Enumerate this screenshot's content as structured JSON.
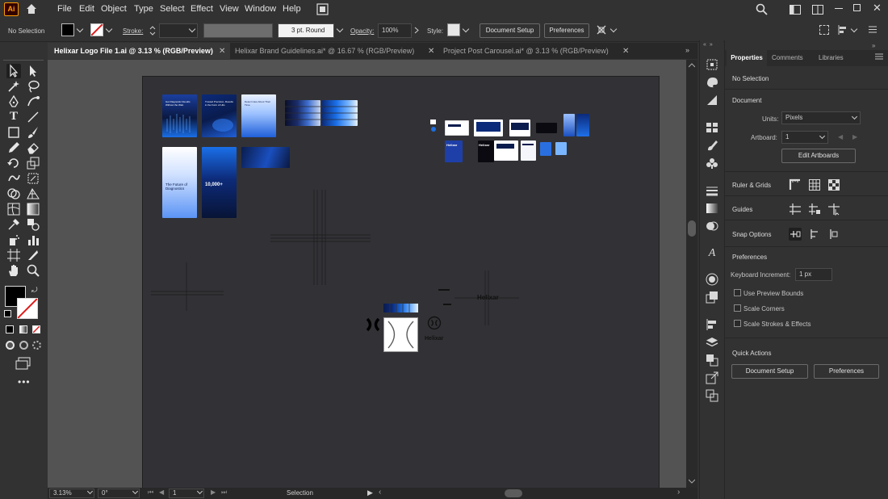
{
  "app": {
    "logo": "Ai"
  },
  "menu": [
    "File",
    "Edit",
    "Object",
    "Type",
    "Select",
    "Effect",
    "View",
    "Window",
    "Help"
  ],
  "control": {
    "selection": "No Selection",
    "stroke_label": "Stroke:",
    "stroke_profile": "3 pt. Round",
    "opacity_label": "Opacity:",
    "opacity_value": "100%",
    "style_label": "Style:",
    "document_setup": "Document Setup",
    "preferences": "Preferences"
  },
  "tabs": [
    {
      "label": "Helixar Logo File 1.ai @ 3.13 % (RGB/Preview)",
      "active": true
    },
    {
      "label": "Helixar Brand Guidelines.ai* @ 16.67 % (RGB/Preview)",
      "active": false
    },
    {
      "label": "Project Post Carousel.ai* @ 3.13 % (RGB/Preview)",
      "active": false
    }
  ],
  "artwork": {
    "posters": [
      "Get Diagnostic Results Without the Wait.",
      "Trusted Precision, Results in the Form of Hits",
      "Detect Care About Their Time.",
      "The Future of Diagnostics",
      "10,000+"
    ],
    "brand_name": "Helixar",
    "wordmark": "Helixar"
  },
  "status": {
    "zoom": "3.13%",
    "rotation": "0°",
    "artboard": "1",
    "tool": "Selection"
  },
  "panel": {
    "tabs": [
      "Properties",
      "Comments",
      "Libraries"
    ],
    "no_selection": "No Selection",
    "document": "Document",
    "units_label": "Units:",
    "units_value": "Pixels",
    "artboard_label": "Artboard:",
    "artboard_value": "1",
    "edit_artboards": "Edit Artboards",
    "ruler_grids": "Ruler & Grids",
    "guides": "Guides",
    "snap_options": "Snap Options",
    "preferences": "Preferences",
    "keyboard_increment_label": "Keyboard Increment:",
    "keyboard_increment_value": "1 px",
    "use_preview_bounds": "Use Preview Bounds",
    "scale_corners": "Scale Corners",
    "scale_strokes": "Scale Strokes & Effects",
    "quick_actions": "Quick Actions",
    "qa_document_setup": "Document Setup",
    "qa_preferences": "Preferences"
  },
  "colors": {
    "accent": "#ff9a00",
    "blue": "#1e6fe0",
    "panel": "#323232"
  }
}
